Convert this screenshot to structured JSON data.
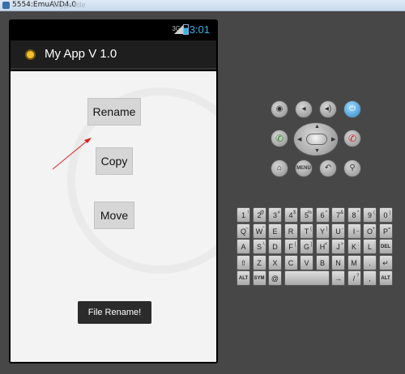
{
  "window": {
    "title": "5554:EmuAVD4.0",
    "faded_text": "Skype title"
  },
  "statusbar": {
    "network": "3G",
    "time": "3:01"
  },
  "app": {
    "title": "My App V 1.0"
  },
  "buttons": {
    "rename": "Rename",
    "copy": "Copy",
    "move": "Move"
  },
  "toast": {
    "text": "File Rename!"
  },
  "annotation": {
    "color": "#e02020"
  },
  "controls": {
    "camera": "camera-icon",
    "vol_down": "volume-down-icon",
    "vol_up": "volume-up-icon",
    "power": "power-icon",
    "call": "call-icon",
    "end_call": "end-call-icon",
    "home": "home-icon",
    "menu": "MENU",
    "back": "back-icon",
    "search": "search-icon"
  },
  "keyboard": {
    "row1": [
      [
        "1",
        "!"
      ],
      [
        "2",
        "@"
      ],
      [
        "3",
        "#"
      ],
      [
        "4",
        "$"
      ],
      [
        "5",
        "%"
      ],
      [
        "6",
        "^"
      ],
      [
        "7",
        "&"
      ],
      [
        "8",
        "*"
      ],
      [
        "9",
        "("
      ],
      [
        "0",
        ")"
      ]
    ],
    "row2": [
      [
        "Q",
        "~"
      ],
      [
        "W",
        "\""
      ],
      [
        "E",
        ""
      ],
      [
        "R",
        ""
      ],
      [
        "T",
        "{"
      ],
      [
        "Y",
        "}"
      ],
      [
        "U",
        "-"
      ],
      [
        "I",
        "_"
      ],
      [
        "O",
        "+"
      ],
      [
        "P",
        "="
      ]
    ],
    "row3": [
      [
        "A",
        ""
      ],
      [
        "S",
        "\\"
      ],
      [
        "D",
        ""
      ],
      [
        "F",
        "["
      ],
      [
        "G",
        "]"
      ],
      [
        "H",
        "<"
      ],
      [
        "J",
        ">"
      ],
      [
        "K",
        ";"
      ],
      [
        "L",
        ":"
      ],
      [
        "DEL",
        ""
      ]
    ],
    "row4": [
      [
        "⇧",
        ""
      ],
      [
        "Z",
        ""
      ],
      [
        "X",
        ""
      ],
      [
        "C",
        ""
      ],
      [
        "V",
        ""
      ],
      [
        "B",
        ""
      ],
      [
        "N",
        ""
      ],
      [
        "M",
        ""
      ],
      [
        ".",
        ""
      ],
      [
        "↵",
        ""
      ]
    ],
    "row5": [
      [
        "ALT",
        ""
      ],
      [
        "SYM",
        ""
      ],
      [
        "@",
        ""
      ],
      [
        "space",
        ""
      ],
      [
        "→",
        ""
      ],
      [
        "/",
        "?"
      ],
      [
        ",",
        ""
      ],
      [
        "ALT",
        ""
      ]
    ]
  }
}
